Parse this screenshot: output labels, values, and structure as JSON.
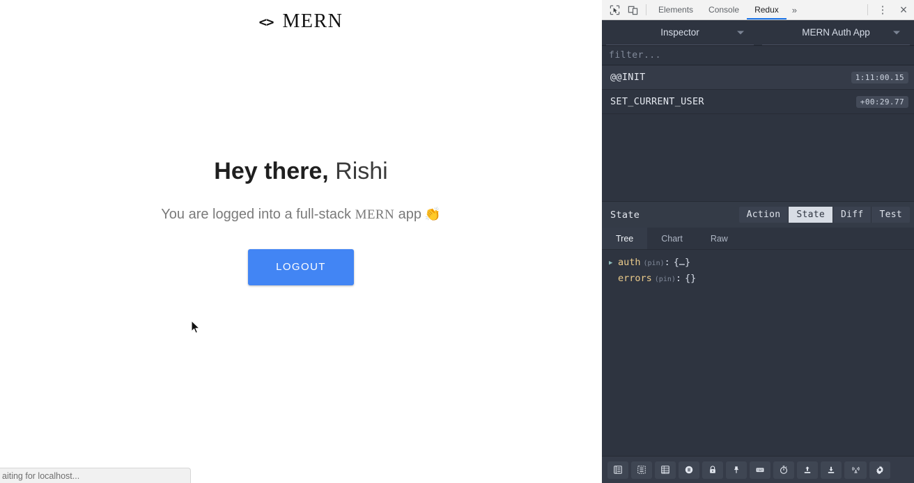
{
  "page": {
    "brand": {
      "code": "<>",
      "name": "MERN"
    },
    "hero": {
      "greeting": "Hey there,",
      "username": "Rishi",
      "sub_before": "You are logged into a full-stack",
      "sub_mern": "MERN",
      "sub_after": "app",
      "sub_emoji": "👏"
    },
    "logout_label": "LOGOUT",
    "status_text": "aiting for localhost...",
    "accent_color": "#4285f4"
  },
  "devtools": {
    "topbar": {
      "inspect_icon": "inspect-element-icon",
      "device_icon": "device-toolbar-icon",
      "tabs": [
        {
          "label": "Elements",
          "active": false
        },
        {
          "label": "Console",
          "active": false
        },
        {
          "label": "Redux",
          "active": true
        }
      ],
      "more_label": "»",
      "kebab_label": "⋮",
      "close_label": "×",
      "active_tab_color": "#1a73e8"
    },
    "selectors": {
      "left": "Inspector",
      "right": "MERN Auth App"
    },
    "filter_placeholder": "filter...",
    "actions": [
      {
        "name": "@@INIT",
        "time": "1:11:00.15",
        "selected": true
      },
      {
        "name": "SET_CURRENT_USER",
        "time": "+00:29.77",
        "selected": false
      }
    ],
    "state_panel": {
      "title": "State",
      "segments": [
        {
          "label": "Action",
          "active": false
        },
        {
          "label": "State",
          "active": true
        },
        {
          "label": "Diff",
          "active": false
        },
        {
          "label": "Test",
          "active": false
        }
      ],
      "subtabs": [
        {
          "label": "Tree",
          "active": true
        },
        {
          "label": "Chart",
          "active": false
        },
        {
          "label": "Raw",
          "active": false
        }
      ],
      "tree": [
        {
          "arrow": "▶",
          "key": "auth",
          "pin": "(pin)",
          "colon": ":",
          "value": "{…}"
        },
        {
          "arrow": "",
          "key": "errors",
          "pin": "(pin)",
          "colon": ":",
          "value": "{}"
        }
      ]
    },
    "bottom_tools": [
      "list-view-icon",
      "grid-view-icon",
      "table-view-icon",
      "pause-icon",
      "lock-icon",
      "pin-icon",
      "keyboard-icon",
      "stopwatch-icon",
      "upload-icon",
      "download-icon",
      "broadcast-icon",
      "settings-gear-icon"
    ]
  }
}
